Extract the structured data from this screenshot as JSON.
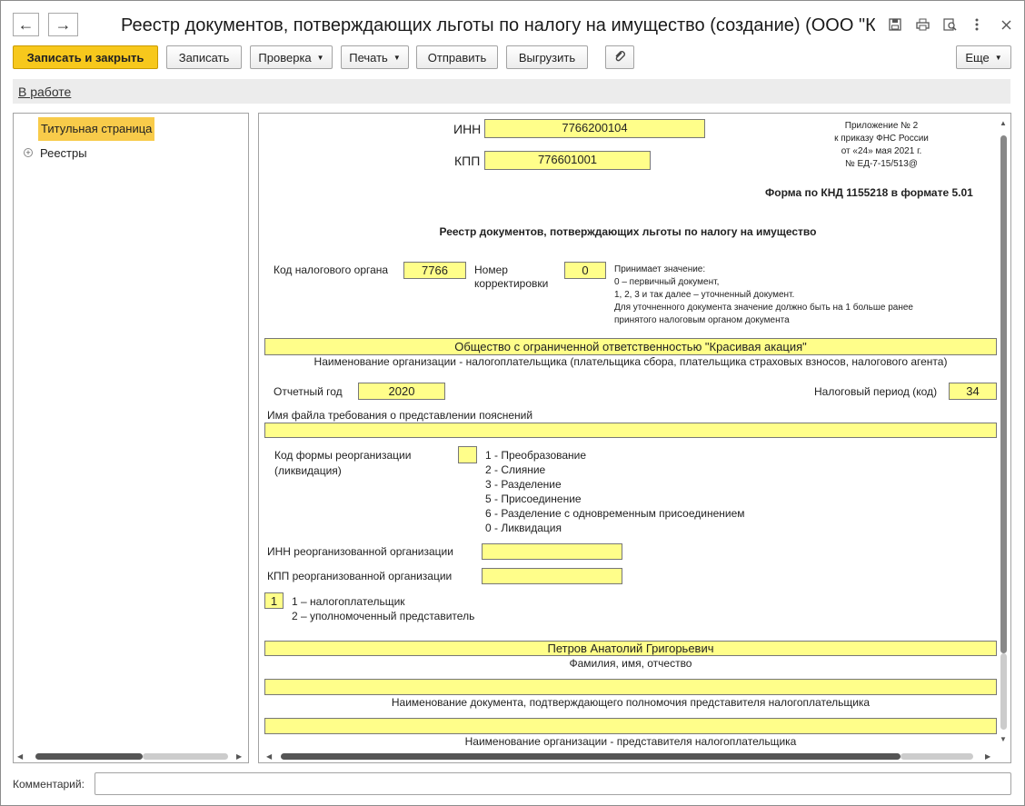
{
  "window": {
    "title": "Реестр документов, потверждающих льготы по налогу на имущество (создание) (ООО \"Крас...",
    "icons": [
      "save-icon",
      "print-icon",
      "preview-icon",
      "more-vertical-icon",
      "close-icon"
    ],
    "nav": {
      "back": "←",
      "forward": "→"
    }
  },
  "toolbar": {
    "save_close": "Записать и закрыть",
    "save": "Записать",
    "check": "Проверка",
    "print": "Печать",
    "send": "Отправить",
    "export": "Выгрузить",
    "more": "Еще"
  },
  "status": {
    "link": "В работе"
  },
  "sidebar": {
    "items": [
      {
        "label": "Титульная страница",
        "selected": true
      },
      {
        "label": "Реестры",
        "expandable": true
      }
    ]
  },
  "form": {
    "inn_label": "ИНН",
    "inn": "7766200104",
    "kpp_label": "КПП",
    "kpp": "776601001",
    "appendix": [
      "Приложение № 2",
      "к приказу ФНС России",
      "от «24» мая 2021 г.",
      "№ ЕД-7-15/513@"
    ],
    "knd": "Форма по КНД 1155218 в формате 5.01",
    "heading": "Реестр документов, потверждающих льготы по налогу на имущество",
    "tax_code_label": "Код налогового органа",
    "tax_code": "7766",
    "corr_label_1": "Номер",
    "corr_label_2": "корректировки",
    "corr_value": "0",
    "corr_hint": [
      "Принимает значение:",
      "0 – первичный документ,",
      "1, 2, 3 и так далее – уточненный документ.",
      "Для уточненного документа значение должно быть на 1 больше ранее",
      "принятого налоговым органом документа"
    ],
    "org_name": "Общество с ограниченной ответственностью \"Красивая акация\"",
    "org_caption": "Наименование организации - налогоплательщика (плательщика сбора, плательщика страховых взносов, налогового агента)",
    "year_label": "Отчетный год",
    "year": "2020",
    "period_label": "Налоговый период (код)",
    "period": "34",
    "filename_label": "Имя файла требования о представлении пояснений",
    "filename": "",
    "reorg_label_1": "Код формы реорганизации",
    "reorg_label_2": "(ликвидация)",
    "reorg_value": "",
    "reorg_options": [
      "1 - Преобразование",
      "2 - Слияние",
      "3 - Разделение",
      "5 - Присоединение",
      "6 - Разделение с одновременным присоединением",
      "0 - Ликвидация"
    ],
    "reorg_inn_label": "ИНН реорганизованной организации",
    "reorg_inn": "",
    "reorg_kpp_label": "КПП реорганизованной организации",
    "reorg_kpp": "",
    "signer_value": "1",
    "signer_options": [
      "1 – налогоплательщик",
      "2 – уполномоченный представитель"
    ],
    "fio": "Петров Анатолий Григорьевич",
    "fio_caption": "Фамилия, имя, отчество",
    "doc_name": "",
    "doc_caption": "Наименование документа, подтверждающего полномочия представителя налогоплательщика",
    "rep_org": "",
    "rep_caption": "Наименование организации - представителя налогоплательщика"
  },
  "comment": {
    "label": "Комментарий:",
    "value": ""
  },
  "colors": {
    "accent": "#f7c81c",
    "field": "#fffe8a",
    "selected": "#f8cb4a"
  }
}
